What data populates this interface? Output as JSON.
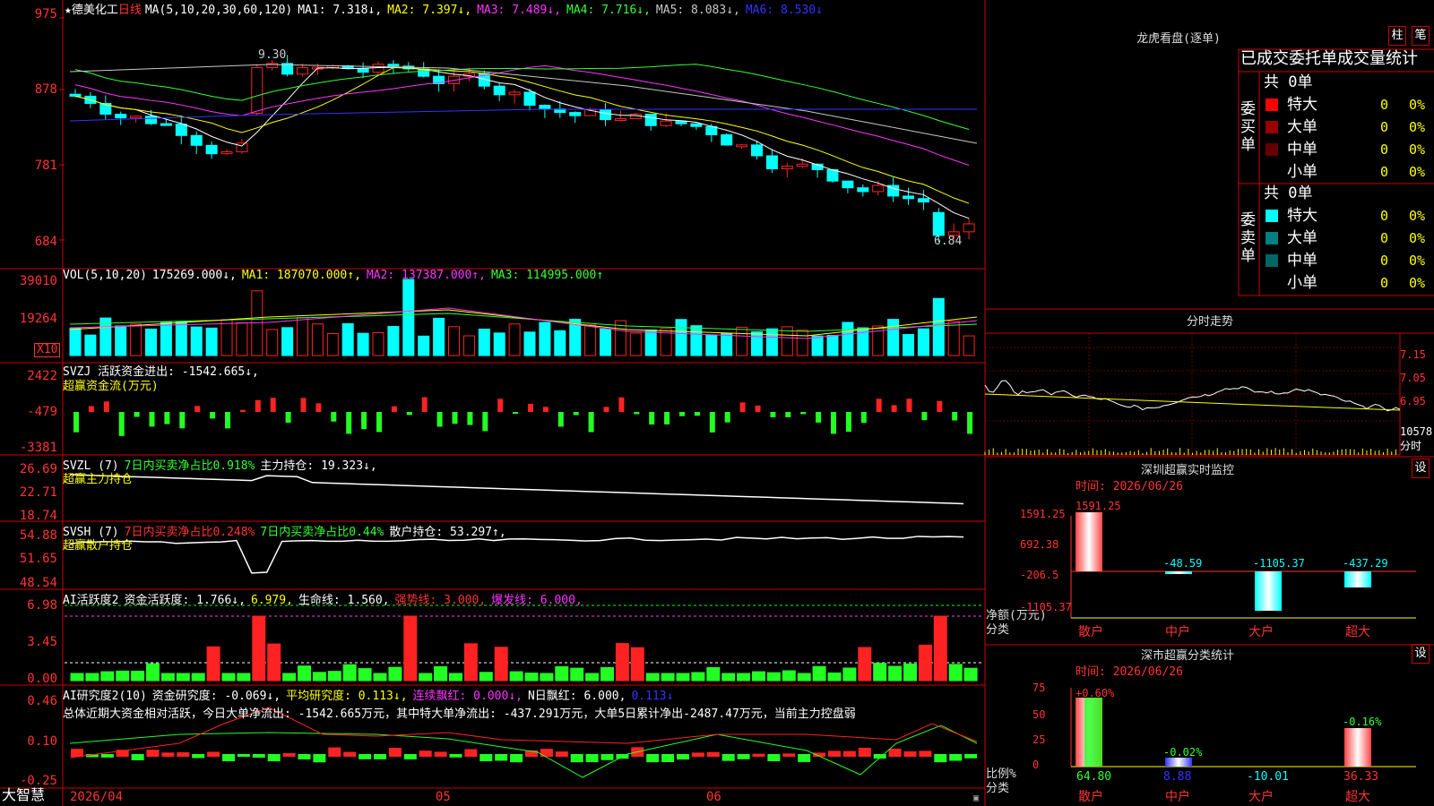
{
  "stock": {
    "star": "★",
    "name": "德美化工",
    "period": "日线"
  },
  "ma_line": [
    {
      "t": "MA(5,10,20,30,60,120)",
      "c": "#ffffff"
    },
    {
      "t": "MA1: 7.318↓,",
      "c": "#ffffff"
    },
    {
      "t": "MA2: 7.397↓,",
      "c": "#ffff00"
    },
    {
      "t": "MA3: 7.489↓,",
      "c": "#ff33ff"
    },
    {
      "t": "MA4: 7.716↓,",
      "c": "#33ff33"
    },
    {
      "t": "MA5: 8.083↓,",
      "c": "#c8c8c8"
    },
    {
      "t": "MA6: 8.530↓",
      "c": "#3333ff"
    }
  ],
  "price_axis": [
    "975",
    "878",
    "781",
    "684"
  ],
  "price_marks": {
    "high": "9.30",
    "low": "6.84"
  },
  "vol_line": [
    {
      "t": "VOL(5,10,20)",
      "c": "#ffffff"
    },
    {
      "t": "175269.000↓,",
      "c": "#ffffff"
    },
    {
      "t": "MA1: 187070.000↑,",
      "c": "#ffff00"
    },
    {
      "t": "MA2: 137387.000↑,",
      "c": "#ff33ff"
    },
    {
      "t": "MA3: 114995.000↑",
      "c": "#33ff33"
    }
  ],
  "vol_axis": [
    "39010",
    "19264"
  ],
  "vol_unit": "X10",
  "svzj_line": [
    {
      "t": "SVZJ  活跃资金进出: -1542.665↓,",
      "c": "#ffffff"
    }
  ],
  "svzj_sub": "超赢资金流(万元)",
  "svzj_axis": [
    "2422",
    "-479",
    "-3381"
  ],
  "svzl_line": [
    {
      "t": "SVZL (7)",
      "c": "#ffffff"
    },
    {
      "t": "7日内买卖净占比0.918%",
      "c": "#33ff33"
    },
    {
      "t": "主力持仓: 19.323↓,",
      "c": "#ffffff"
    }
  ],
  "svzl_sub": "超赢主力持仓",
  "svzl_axis": [
    "26.69",
    "22.71",
    "18.74"
  ],
  "svsh_line": [
    {
      "t": "SVSH (7)",
      "c": "#ffffff"
    },
    {
      "t": "7日内买卖净占比0.248%",
      "c": "#ff3333"
    },
    {
      "t": "7日内买卖净占比0.44%",
      "c": "#33ff33"
    },
    {
      "t": "散户持仓: 53.297↑,",
      "c": "#ffffff"
    }
  ],
  "svsh_sub": "超赢散户持仓",
  "svsh_axis": [
    "54.88",
    "51.65",
    "48.54"
  ],
  "ai1_line": [
    {
      "t": "AI活跃度2",
      "c": "#ffffff"
    },
    {
      "t": "资金活跃度: 1.766↓,",
      "c": "#ffffff"
    },
    {
      "t": "6.979,",
      "c": "#ffff00"
    },
    {
      "t": "生命线: 1.560,",
      "c": "#ffffff"
    },
    {
      "t": "强势线: 3.000,",
      "c": "#ff3333"
    },
    {
      "t": "爆发线: 6.000,",
      "c": "#ff33ff"
    }
  ],
  "ai1_axis": [
    "6.98",
    "3.45",
    "0.00"
  ],
  "ai2_line": [
    {
      "t": "AI研究度2(10)",
      "c": "#ffffff"
    },
    {
      "t": "资金研究度: -0.069↓,",
      "c": "#ffffff"
    },
    {
      "t": "平均研究度: 0.113↓,",
      "c": "#ffff00"
    },
    {
      "t": "连续飘红: 0.000↓,",
      "c": "#ff33ff"
    },
    {
      "t": "N日飘红: 6.000,",
      "c": "#ffffff"
    },
    {
      "t": "0.113↓",
      "c": "#3333ff"
    }
  ],
  "ai2_summary": "总体近期大资金相对活跃，今日大单净流出: -1542.665万元，其中特大单净流出: -437.291万元，大单5日累计净出-2487.47万元，当前主力控盘弱",
  "ai2_axis": [
    "0.46",
    "0.10",
    "-0.25"
  ],
  "date_axis": [
    "2026/04",
    "05",
    "06"
  ],
  "brand": "大智慧",
  "right": {
    "longhu_title": "龙虎看盘(逐单)",
    "btn_zhu": "柱",
    "btn_bi": "笔",
    "stat_header": "已成交委托单成交量统计",
    "buy_label": "委买单",
    "sell_label": "委卖单",
    "buy_total": "共 0单",
    "sell_total": "共 0单",
    "rows": [
      {
        "name": "特大",
        "v": "0",
        "p": "0%"
      },
      {
        "name": "大单",
        "v": "0",
        "p": "0%"
      },
      {
        "name": "中单",
        "v": "0",
        "p": "0%"
      },
      {
        "name": "小单",
        "v": "0",
        "p": "0%"
      }
    ],
    "buy_colors": [
      "#ff0000",
      "#990000",
      "#660000",
      ""
    ],
    "sell_colors": [
      "#00ffff",
      "#008080",
      "#006666",
      ""
    ],
    "fenshi_title": "分时走势",
    "fenshi_axis": [
      "7.15",
      "7.05",
      "6.95"
    ],
    "fenshi_vol": "10578",
    "fenshi_vol_label": "分时",
    "sz_monitor_title": "深圳超赢实时监控",
    "btn_set": "设",
    "sz_time": "时间: 2026/06/26",
    "sz_axis": [
      "1591.25",
      "692.38",
      "-206.5",
      "-1105.37"
    ],
    "sz_axis_label1": "净额(万元)",
    "sz_axis_label2": "分类",
    "categories": [
      "散户",
      "中户",
      "大户",
      "超大"
    ],
    "sz_values": [
      "1591.25",
      "-48.59",
      "-1105.37",
      "-437.29"
    ],
    "sz_class_title": "深市超赢分类统计",
    "sc_time": "时间: 2026/06/26",
    "sc_axis": [
      "75",
      "50",
      "25",
      "0"
    ],
    "sc_axis_label1": "比例%",
    "sc_axis_label2": "分类",
    "sc_top": [
      "+0.60%",
      "-0.02%",
      "",
      "-0.16%"
    ],
    "sc_bottom": [
      "64.80",
      "8.88",
      "-10.01",
      "36.33"
    ]
  }
}
